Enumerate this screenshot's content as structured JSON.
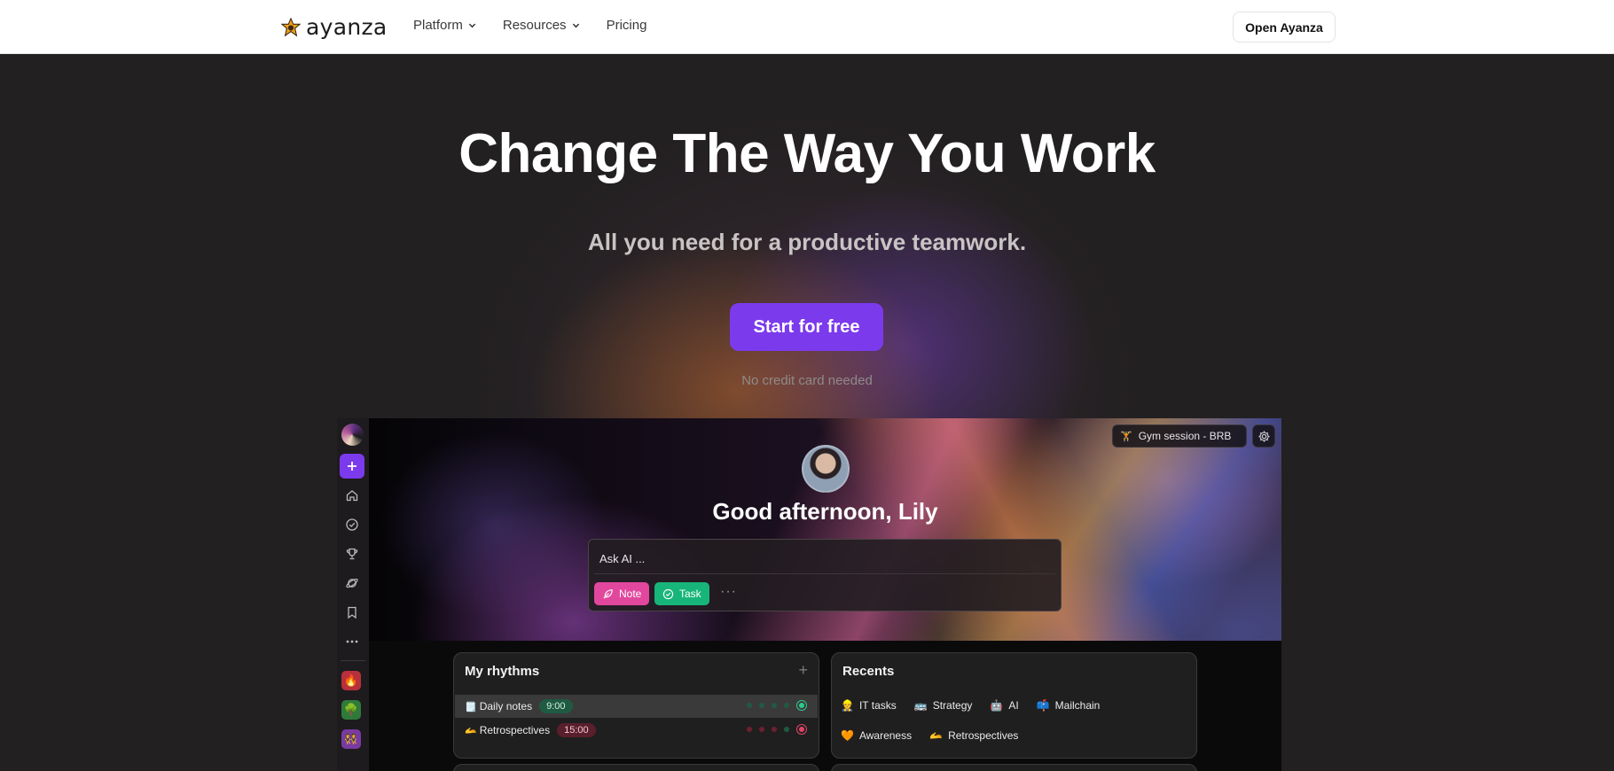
{
  "nav": {
    "logo_text": "ayanza",
    "links": [
      {
        "label": "Platform",
        "has_dropdown": true
      },
      {
        "label": "Resources",
        "has_dropdown": true
      },
      {
        "label": "Pricing",
        "has_dropdown": false
      }
    ],
    "open_button": "Open Ayanza"
  },
  "hero": {
    "title": "Change The Way You Work",
    "subtitle": "All you need for a productive teamwork.",
    "cta": "Start for free",
    "note": "No credit card needed"
  },
  "app": {
    "status": {
      "icon": "dumbbell-icon",
      "text": "Gym session - BRB"
    },
    "greeting": "Good afternoon, Lily",
    "ask_placeholder": "Ask AI ...",
    "chips": {
      "note": "Note",
      "task": "Task",
      "more": "···"
    },
    "sidebar": {
      "icons": [
        "home-icon",
        "check-circle-icon",
        "trophy-icon",
        "planet-icon",
        "bookmark-icon",
        "more-icon"
      ],
      "workspaces": [
        {
          "emoji": "🔥",
          "color": "#b7303c"
        },
        {
          "emoji": "🌳",
          "color": "#2f7a3a"
        },
        {
          "emoji": "👯",
          "color": "#7a3aa3"
        }
      ]
    },
    "rhythms": {
      "title": "My rhythms",
      "add": "+",
      "items": [
        {
          "emoji": "🗒️",
          "label": "Daily notes",
          "time": "9:00",
          "tone": "green"
        },
        {
          "emoji": "🫴",
          "label": "Retrospectives",
          "time": "15:00",
          "tone": "red"
        }
      ]
    },
    "recents": {
      "title": "Recents",
      "row1": [
        {
          "emoji": "👷",
          "label": "IT tasks"
        },
        {
          "emoji": "🚌",
          "label": "Strategy"
        },
        {
          "emoji": "🤖",
          "label": "AI"
        },
        {
          "emoji": "📫",
          "label": "Mailchain"
        }
      ],
      "row2": [
        {
          "emoji": "🧡",
          "label": "Awareness"
        },
        {
          "emoji": "🫴",
          "label": "Retrospectives"
        }
      ]
    }
  },
  "colors": {
    "accent": "#7c3aed",
    "note": "#e2479e",
    "task": "#17b57a"
  }
}
